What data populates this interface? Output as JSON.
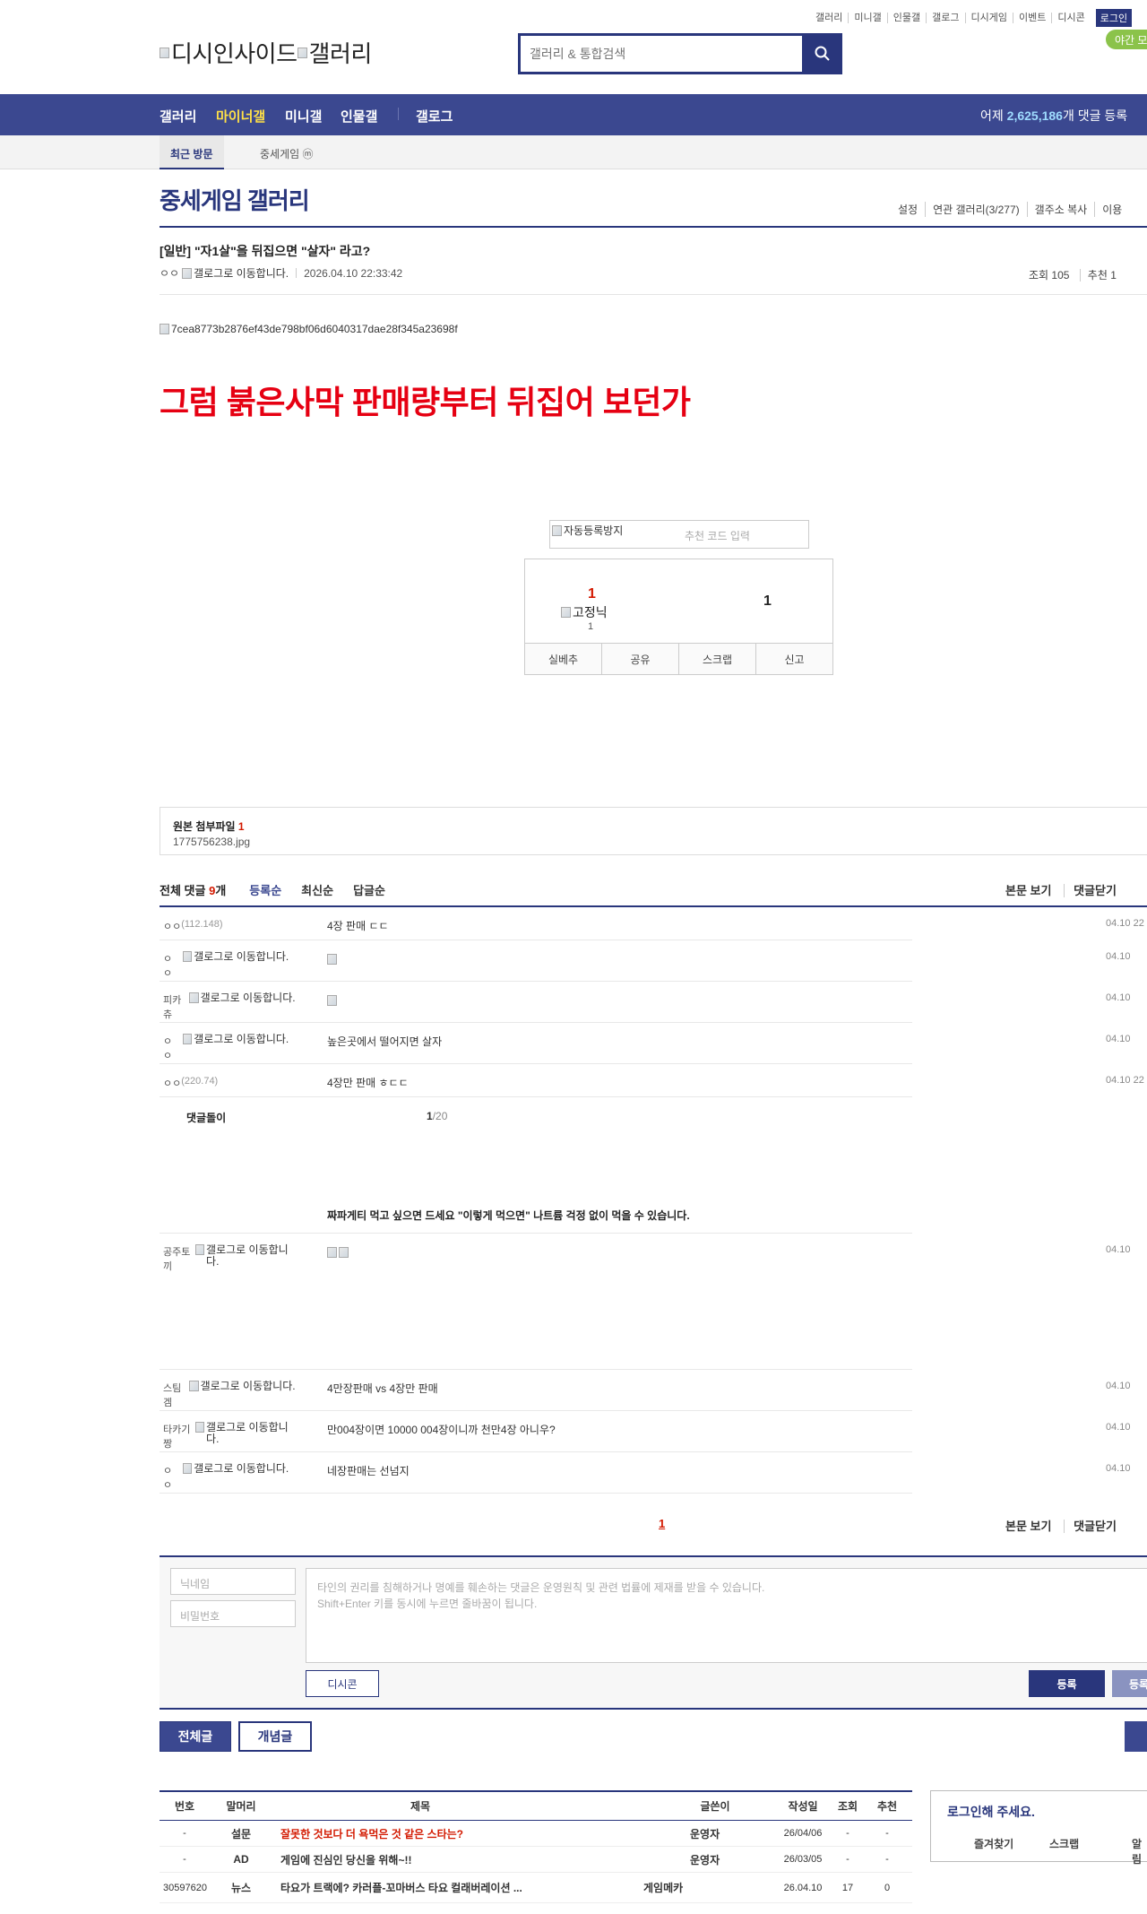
{
  "top_menu": [
    "갤러리",
    "미니갤",
    "인물갤",
    "갤로그",
    "디시게임",
    "이벤트",
    "디시콘"
  ],
  "login_label": "로그인",
  "night_mode_label": "야간 모",
  "logo_alt": "디시인사이드",
  "gallery_logo_alt": "갤러리",
  "search": {
    "placeholder": "갤러리 & 통합검색"
  },
  "nav": {
    "items": [
      "갤러리",
      "마이너갤",
      "미니갤",
      "인물갤",
      "갤로그"
    ],
    "active": "마이너갤"
  },
  "stats": {
    "prefix": "어제 ",
    "count": "2,625,186",
    "suffix": "개 댓글 등록"
  },
  "subnav": {
    "active": "최근 방문",
    "recent": "중세게임 ⓜ"
  },
  "gallery": {
    "title": "중세게임 갤러리",
    "links": [
      "설정",
      "연관 갤러리(3/277)",
      "갤주소 복사",
      "이용"
    ]
  },
  "post": {
    "title": "[일반] \"자1살\"을 뒤집으면 \"살자\" 라고?",
    "author": "ㅇㅇ",
    "author_img_alt": "갤로그로 이동합니다.",
    "datetime": "2026.04.10 22:33:42",
    "views": "조회 105",
    "recommend": "추천 1",
    "image_alt": "7cea8773b2876ef43de798bf06d6040317dae28f345a23698f",
    "body": "그럼 붉은사막 판매량부터 뒤집어 보던가"
  },
  "captcha": {
    "alt": "자동등록방지",
    "placeholder": "추천 코드 입력"
  },
  "recommend_box": {
    "up": "1",
    "fixed_alt": "고정닉",
    "fixed_count": "1",
    "down": "1",
    "buttons": [
      "실베추",
      "공유",
      "스크랩",
      "신고"
    ]
  },
  "attachment": {
    "label": "원본 첨부파일",
    "count": "1",
    "file": "1775756238.jpg"
  },
  "comments_header": {
    "label": "전체 댓글",
    "count": "9",
    "unit": "개",
    "sorts": [
      "등록순",
      "최신순",
      "답글순"
    ],
    "right": [
      "본문 보기",
      "댓글닫기"
    ]
  },
  "comments": [
    {
      "nick": "ㅇㅇ",
      "ip": "(112.148)",
      "gallog": "",
      "text": "4장 판매 ㄷㄷ",
      "date": "04.10 22"
    },
    {
      "nick": "ㅇㅇ",
      "ip": "",
      "gallog": "갤로그로 이동합니다.",
      "text": "",
      "date": "04.10"
    },
    {
      "nick": "피카츄",
      "ip": "",
      "gallog": "갤로그로 이동합니다.",
      "text": "",
      "date": "04.10"
    },
    {
      "nick": "ㅇㅇ",
      "ip": "",
      "gallog": "갤로그로 이동합니다.",
      "text": "높은곳에서 떨어지면 살자",
      "date": "04.10"
    },
    {
      "nick": "ㅇㅇ",
      "ip": "(220.74)",
      "gallog": "",
      "text": "4장만 판매 ㅎㄷㄷ",
      "date": "04.10 22"
    },
    {
      "nick": "공주토끼",
      "ip": "",
      "gallog": "갤로그로 이동합니다.",
      "text": "",
      "date": "04.10"
    },
    {
      "nick": "스팀겜",
      "ip": "",
      "gallog": "갤로그로 이동합니다.",
      "text": "4만장판매 vs 4장만 판매",
      "date": "04.10"
    },
    {
      "nick": "타카기짱",
      "ip": "",
      "gallog": "갤로그로 이동합니다.",
      "text": "만004장이면 10000 004장이니까 천만4장 아니우?",
      "date": "04.10"
    },
    {
      "nick": "ㅇㅇ",
      "ip": "",
      "gallog": "갤로그로 이동합니다.",
      "text": "네장판매는 선넘지",
      "date": "04.10"
    }
  ],
  "reply_bot": {
    "label": "댓글돌이",
    "page": "1",
    "total": "/20"
  },
  "reply_ad": "짜파게티 먹고 싶으면 드세요 \"이렇게 먹으면\" 나트륨 걱정 없이 먹을 수 있습니다.",
  "paging": {
    "current": "1"
  },
  "write": {
    "nickname_placeholder": "닉네임",
    "password_placeholder": "비밀번호",
    "notice_line1": "타인의 권리를 침해하거나 명예를 훼손하는 댓글은 운영원칙 및 관련 법률에 제재를 받을 수 있습니다.",
    "notice_line2": "Shift+Enter 키를 동시에 누르면 줄바꿈이 됩니다.",
    "dccon": "디시콘",
    "submit": "등록",
    "submit2": "등록"
  },
  "list_buttons": {
    "all": "전체글",
    "concept": "개념글"
  },
  "list": {
    "headers": [
      "번호",
      "말머리",
      "제목",
      "글쓴이",
      "작성일",
      "조회",
      "추천"
    ],
    "rows": [
      {
        "num": "-",
        "head": "설문",
        "title": "잘못한 것보다 더 욕먹은 것 같은 스타는?",
        "writer": "운영자",
        "date": "26/04/06",
        "views": "-",
        "rec": "-",
        "hot": true
      },
      {
        "num": "-",
        "head": "AD",
        "title": "게임에 진심인 당신을 위해~!!",
        "writer": "운영자",
        "date": "26/03/05",
        "views": "-",
        "rec": "-",
        "hot": false
      },
      {
        "num": "30597620",
        "head": "뉴스",
        "title": "타요가 트랙에? 카러플-꼬마버스 타요 컬래버레이션 ...",
        "writer": "게임메카",
        "date": "26.04.10",
        "views": "17",
        "rec": "0",
        "hot": false
      }
    ]
  },
  "login_box": {
    "title": "로그인해 주세요.",
    "links": [
      "즐겨찾기",
      "스크랩",
      "알림"
    ]
  },
  "colors": {
    "primary": "#29367c",
    "nav": "#3b4890",
    "accent_red": "#e60012",
    "highlight": "#d31900"
  }
}
